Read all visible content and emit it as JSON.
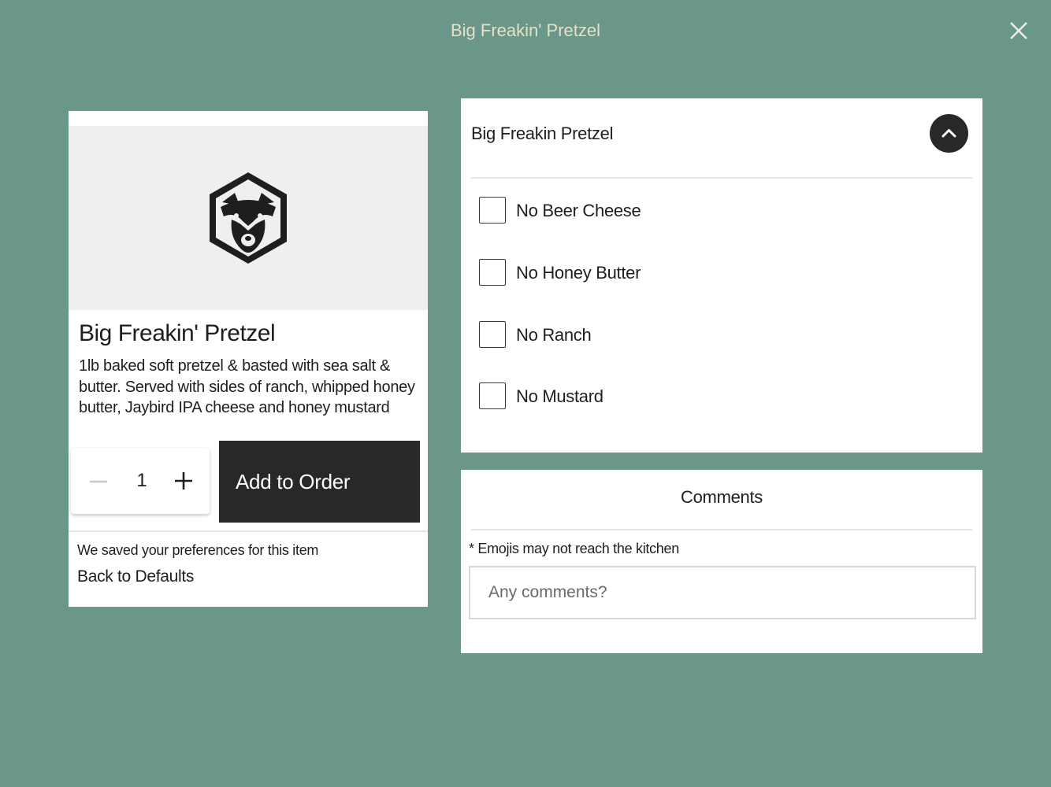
{
  "header": {
    "title": "Big Freakin' Pretzel"
  },
  "item": {
    "name": "Big Freakin' Pretzel",
    "description": "1lb baked soft pretzel & basted with sea salt & butter. Served with sides of ranch, whipped honey butter, Jaybird IPA cheese and honey mustard",
    "quantity": "1",
    "add_label": "Add to Order",
    "pref_note": "We saved your preferences for this item",
    "back_defaults": "Back to Defaults",
    "logo": "raccoon-hexagon-logo"
  },
  "options": {
    "title": "Big Freakin Pretzel",
    "items": [
      {
        "label": "No Beer Cheese",
        "checked": false
      },
      {
        "label": "No Honey Butter",
        "checked": false
      },
      {
        "label": "No Ranch",
        "checked": false
      },
      {
        "label": "No Mustard",
        "checked": false
      }
    ]
  },
  "comments": {
    "title": "Comments",
    "note": "* Emojis may not reach the kitchen",
    "placeholder": "Any comments?",
    "value": ""
  },
  "colors": {
    "background": "#6b978a",
    "title_text": "#e8e0c6",
    "dark_button": "#28282b"
  },
  "icons": [
    "close-icon",
    "minus-icon",
    "plus-icon",
    "chevron-up-icon"
  ]
}
